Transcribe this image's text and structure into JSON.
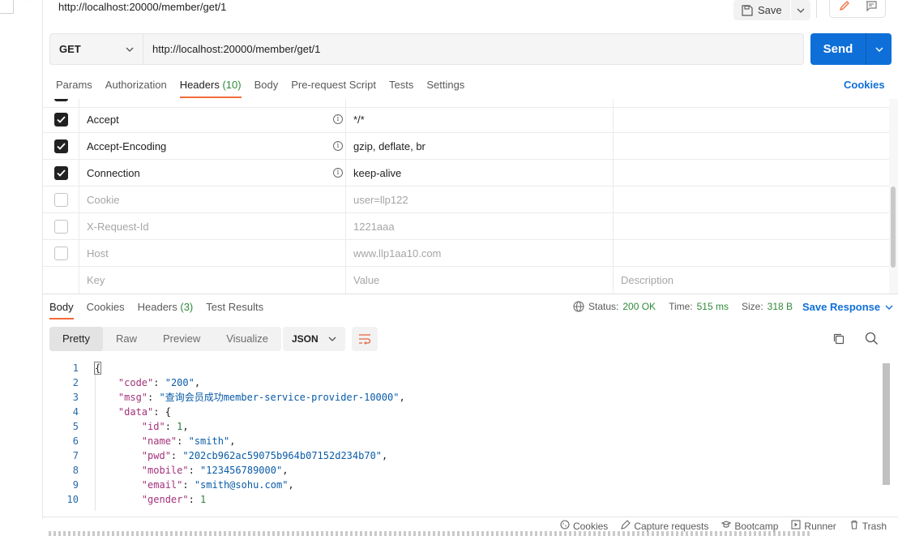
{
  "request": {
    "title": "http://localhost:20000/member/get/1",
    "save_label": "Save",
    "method": "GET",
    "url": "http://localhost:20000/member/get/1",
    "send_label": "Send"
  },
  "request_tabs": [
    {
      "label": "Params"
    },
    {
      "label": "Authorization"
    },
    {
      "label": "Headers",
      "count": "(10)",
      "active": true
    },
    {
      "label": "Body"
    },
    {
      "label": "Pre-request Script"
    },
    {
      "label": "Tests"
    },
    {
      "label": "Settings"
    }
  ],
  "cookies_link": "Cookies",
  "headers": [
    {
      "checked": true,
      "key": "Accept",
      "value": "*/*",
      "info": true
    },
    {
      "checked": true,
      "key": "Accept-Encoding",
      "value": "gzip, deflate, br",
      "info": true
    },
    {
      "checked": true,
      "key": "Connection",
      "value": "keep-alive",
      "info": true
    },
    {
      "checked": false,
      "key": "Cookie",
      "value": "user=llp122"
    },
    {
      "checked": false,
      "key": "X-Request-Id",
      "value": "1221aaa"
    },
    {
      "checked": false,
      "key": "Host",
      "value": "www.llp1aa10.com"
    }
  ],
  "headers_placeholder": {
    "key": "Key",
    "value": "Value",
    "description": "Description"
  },
  "response_tabs": [
    {
      "label": "Body",
      "active": true
    },
    {
      "label": "Cookies"
    },
    {
      "label": "Headers",
      "count": "(3)"
    },
    {
      "label": "Test Results"
    }
  ],
  "response_status": {
    "status_label": "Status:",
    "status": "200 OK",
    "time_label": "Time:",
    "time": "515 ms",
    "size_label": "Size:",
    "size": "318 B"
  },
  "save_response_label": "Save Response",
  "view_tabs": [
    "Pretty",
    "Raw",
    "Preview",
    "Visualize"
  ],
  "format": "JSON",
  "code_lines": [
    {
      "n": "1",
      "html": "{"
    },
    {
      "n": "2",
      "html": "    <span class=\"k\">\"code\"</span>: <span class=\"s\">\"200\"</span>,"
    },
    {
      "n": "3",
      "html": "    <span class=\"k\">\"msg\"</span>: <span class=\"s\">\"查询会员成功member-service-provider-10000\"</span>,"
    },
    {
      "n": "4",
      "html": "    <span class=\"k\">\"data\"</span>: {"
    },
    {
      "n": "5",
      "html": "        <span class=\"k\">\"id\"</span>: <span class=\"n\">1</span>,"
    },
    {
      "n": "6",
      "html": "        <span class=\"k\">\"name\"</span>: <span class=\"s\">\"smith\"</span>,"
    },
    {
      "n": "7",
      "html": "        <span class=\"k\">\"pwd\"</span>: <span class=\"s\">\"202cb962ac59075b964b07152d234b70\"</span>,"
    },
    {
      "n": "8",
      "html": "        <span class=\"k\">\"mobile\"</span>: <span class=\"s\">\"123456789000\"</span>,"
    },
    {
      "n": "9",
      "html": "        <span class=\"k\">\"email\"</span>: <span class=\"s\">\"smith@sohu.com\"</span>,"
    },
    {
      "n": "10",
      "html": "        <span class=\"k\">\"gender\"</span>: <span class=\"n\">1</span>"
    }
  ],
  "footer": [
    {
      "icon": "cookie-icon",
      "label": "Cookies"
    },
    {
      "icon": "capture-icon",
      "label": "Capture requests"
    },
    {
      "icon": "bootcamp-icon",
      "label": "Bootcamp"
    },
    {
      "icon": "runner-icon",
      "label": "Runner"
    },
    {
      "icon": "trash-icon",
      "label": "Trash"
    }
  ],
  "colors": {
    "accent": "#0f6fd8",
    "tab_underline": "#f26b3a",
    "ok": "#2f8a3a"
  }
}
